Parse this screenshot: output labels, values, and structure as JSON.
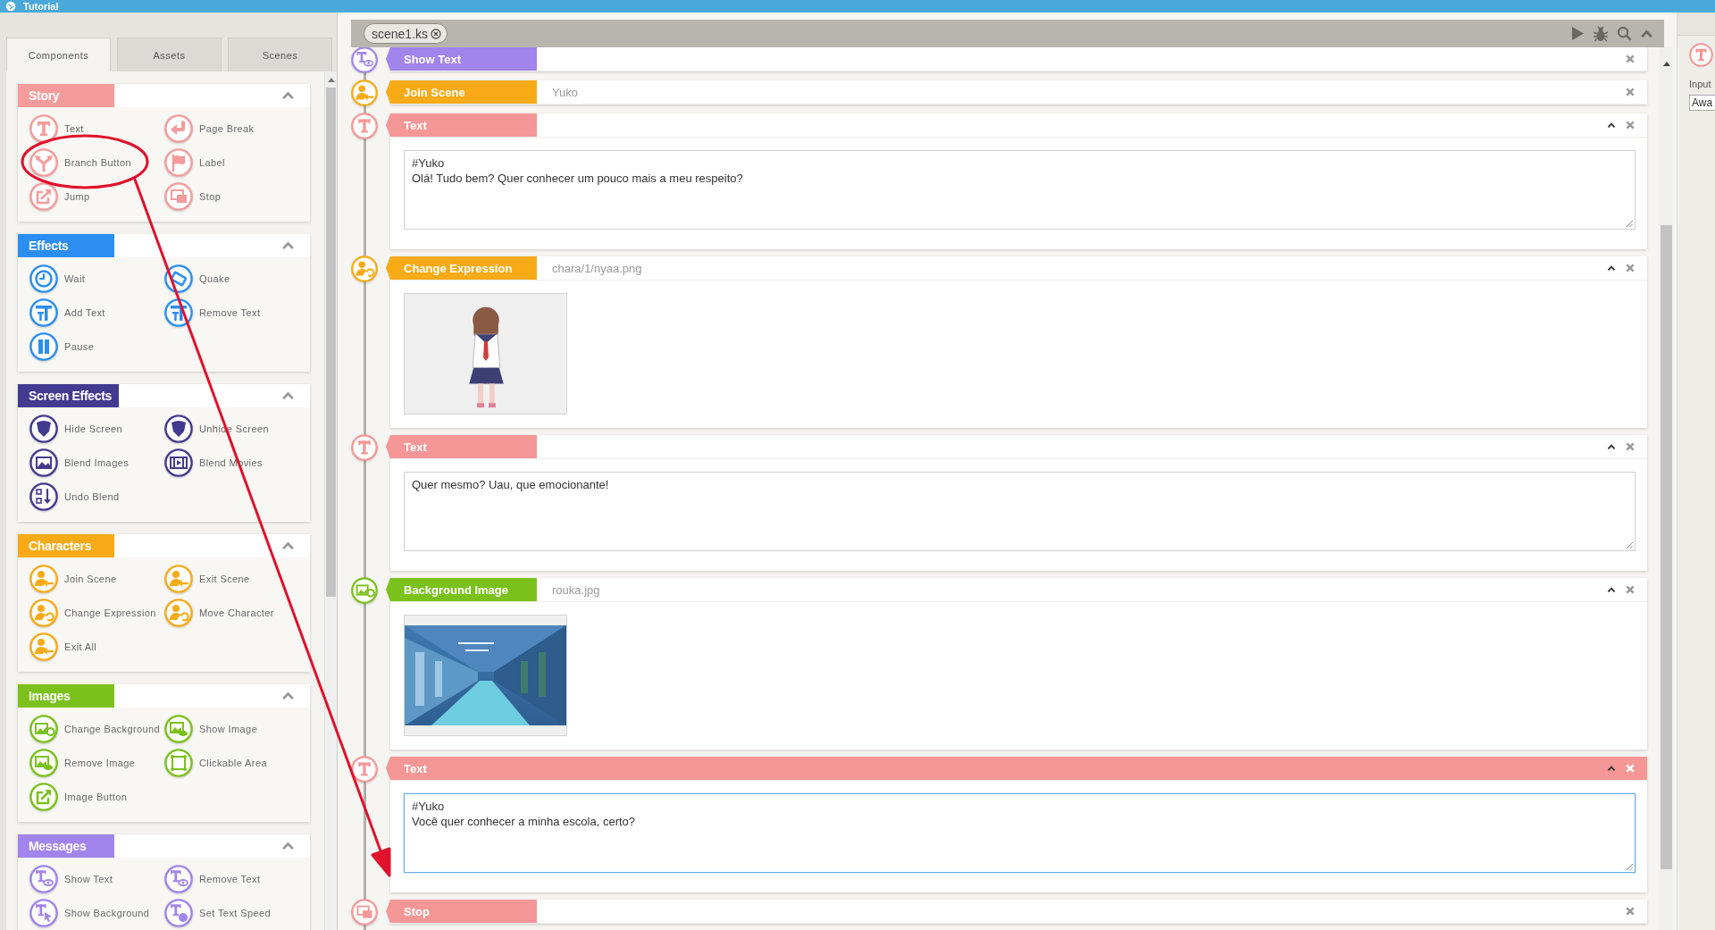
{
  "window": {
    "title": "Tutorial"
  },
  "sidebar": {
    "tabs": [
      {
        "label": "Components",
        "selected": true
      },
      {
        "label": "Assets",
        "selected": false
      },
      {
        "label": "Scenes",
        "selected": false
      }
    ],
    "groups": [
      {
        "title": "Story",
        "color": "#f59b9b",
        "expanded": true,
        "items": [
          "Text",
          "Page Break",
          "Branch Button",
          "Label",
          "Jump",
          "Stop"
        ]
      },
      {
        "title": "Effects",
        "color": "#2b8ef0",
        "expanded": true,
        "items": [
          "Wait",
          "Quake",
          "Add Text",
          "Remove Text",
          "Pause"
        ]
      },
      {
        "title": "Screen Effects",
        "color": "#433b8f",
        "expanded": true,
        "items": [
          "Hide Screen",
          "Unhide Screen",
          "Blend Images",
          "Blend Movies",
          "Undo Blend"
        ]
      },
      {
        "title": "Characters",
        "color": "#f8ab17",
        "expanded": true,
        "items": [
          "Join Scene",
          "Exit Scene",
          "Change Expression",
          "Move Character",
          "Exit All"
        ]
      },
      {
        "title": "Images",
        "color": "#7bc11c",
        "expanded": true,
        "items": [
          "Change Background",
          "Show Image",
          "Remove Image",
          "Clickable Area",
          "Image Button"
        ]
      },
      {
        "title": "Messages",
        "color": "#a184ec",
        "expanded": true,
        "items": [
          "Show Text",
          "Remove Text",
          "Show Background",
          "Set Text Speed"
        ]
      }
    ]
  },
  "editor": {
    "tab": {
      "label": "scene1.ks"
    },
    "blocks": [
      {
        "kind": "show_text",
        "title": "Show Text",
        "color": "#a184ec",
        "selected": false
      },
      {
        "kind": "join_scene",
        "title": "Join Scene",
        "value": "Yuko",
        "color": "#f8ab17",
        "selected": false
      },
      {
        "kind": "text",
        "title": "Text",
        "text": "#Yuko\nOlá! Tudo bem? Quer conhecer um pouco mais a meu respeito?",
        "color": "#f59797",
        "selected": false
      },
      {
        "kind": "change_expression",
        "title": "Change Expression",
        "value": "chara/1/nyaa.png",
        "color": "#f8ab17",
        "selected": false
      },
      {
        "kind": "text",
        "title": "Text",
        "text": "Quer mesmo? Uau, que emocionante!",
        "color": "#f59797",
        "selected": false
      },
      {
        "kind": "background_image",
        "title": "Background Image",
        "value": "rouka.jpg",
        "color": "#7bc11c",
        "selected": false
      },
      {
        "kind": "text",
        "title": "Text",
        "text": "#Yuko\nVocê quer conhecer a minha escola, certo?",
        "color": "#f59797",
        "selected": true
      },
      {
        "kind": "stop",
        "title": "Stop",
        "color": "#f59797",
        "selected": false
      }
    ]
  },
  "inspector": {
    "label": "Input",
    "value": "Awa"
  }
}
